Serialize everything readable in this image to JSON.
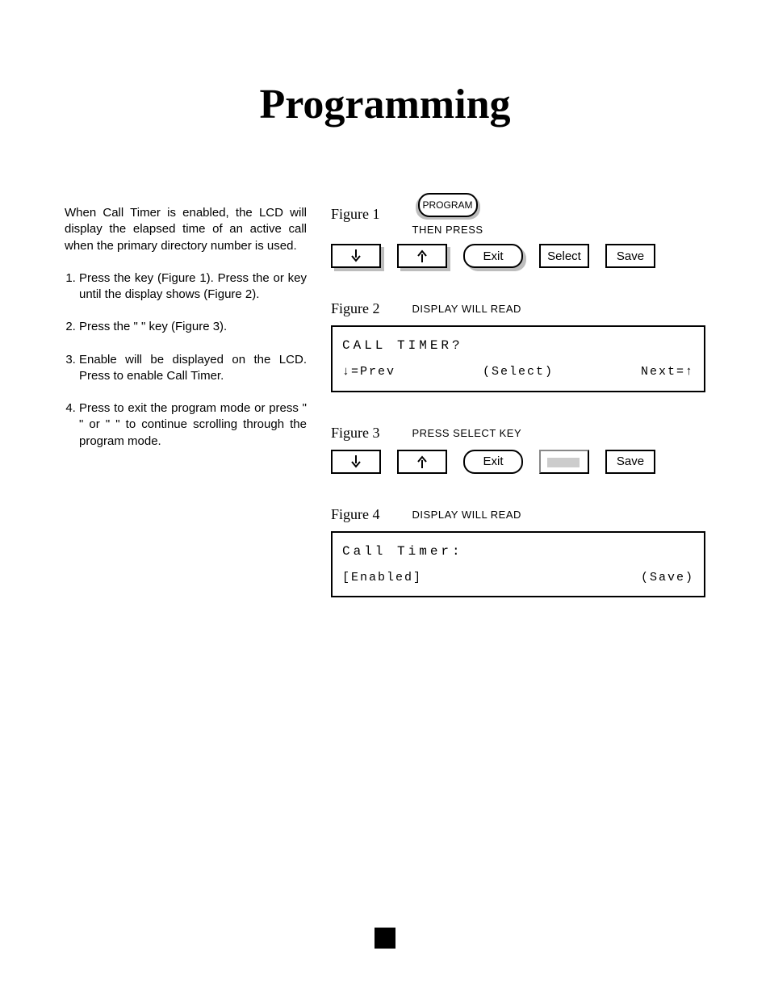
{
  "title": "Programming",
  "intro": "When Call Timer is enabled, the LCD will display the elapsed time of an active call when the primary directory number is used.",
  "steps": [
    "Press the  key (Figure 1). Press the  or  key until the display shows (Figure 2).",
    "Press the \"  \" key (Figure 3).",
    "Enable will be displayed on the LCD. Press  to enable Call Timer.",
    "Press  to exit the program mode or press \"  \" or \"  \" to continue scrolling through the program mode."
  ],
  "figures": {
    "f1": {
      "label": "Figure 1",
      "programBtn": "PROGRAM",
      "thenPress": "THEN PRESS",
      "btns": {
        "exit": "Exit",
        "select": "Select",
        "save": "Save"
      }
    },
    "f2": {
      "label": "Figure 2",
      "note": "DISPLAY WILL READ",
      "lcdLine1": "CALL TIMER?",
      "lcdPrev": "↓=Prev",
      "lcdSelect": "(Select)",
      "lcdNext": "Next=↑"
    },
    "f3": {
      "label": "Figure 3",
      "note": "PRESS SELECT KEY",
      "btns": {
        "exit": "Exit",
        "save": "Save"
      }
    },
    "f4": {
      "label": "Figure 4",
      "note": "DISPLAY WILL READ",
      "lcdLine1": "Call Timer:",
      "lcdLeft": "[Enabled]",
      "lcdRight": "(Save)"
    }
  }
}
